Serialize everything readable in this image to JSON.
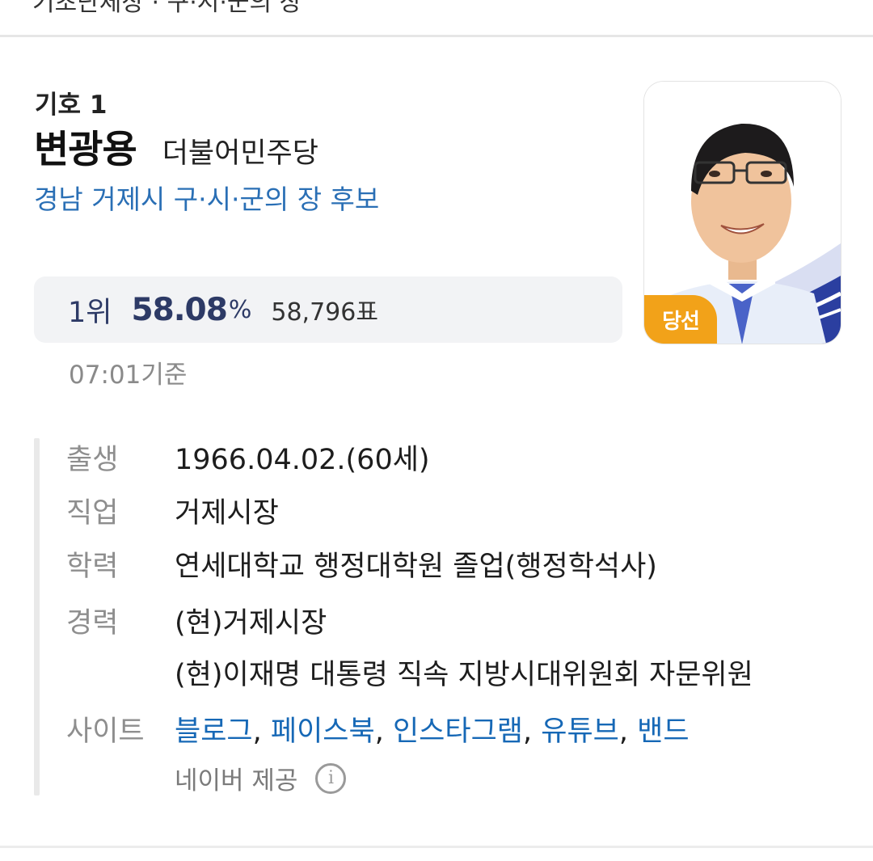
{
  "header": {
    "partial_text": "기초단체장 · 구·시·군의 장"
  },
  "candidate": {
    "symbol": "기호 1",
    "name": "변광용",
    "party": "더불어민주당",
    "race": "경남 거제시 구·시·군의 장 후보",
    "result": {
      "rank": "1위",
      "percent": "58.08",
      "percent_unit": "%",
      "votes": "58,796표"
    },
    "as_of": "07:01기준",
    "badge": "당선"
  },
  "info": {
    "birth": {
      "label": "출생",
      "value": "1966.04.02.(60세)"
    },
    "job": {
      "label": "직업",
      "value": "거제시장"
    },
    "education": {
      "label": "학력",
      "value": "연세대학교 행정대학원 졸업(행정학석사)"
    },
    "career": {
      "label": "경력",
      "values": [
        "(현)거제시장",
        "(현)이재명 대통령 직속 지방시대위원회 자문위원"
      ]
    },
    "sites": {
      "label": "사이트",
      "links": [
        "블로그",
        "페이스북",
        "인스타그램",
        "유튜브",
        "밴드"
      ],
      "separator": ","
    },
    "provider": "네이버 제공",
    "info_icon_glyph": "i"
  },
  "colors": {
    "link": "#1668b6",
    "race": "#2a6fb5",
    "result": "#2d3a66",
    "badge": "#f2a219"
  },
  "icons": {
    "info": "info-circle-icon"
  }
}
